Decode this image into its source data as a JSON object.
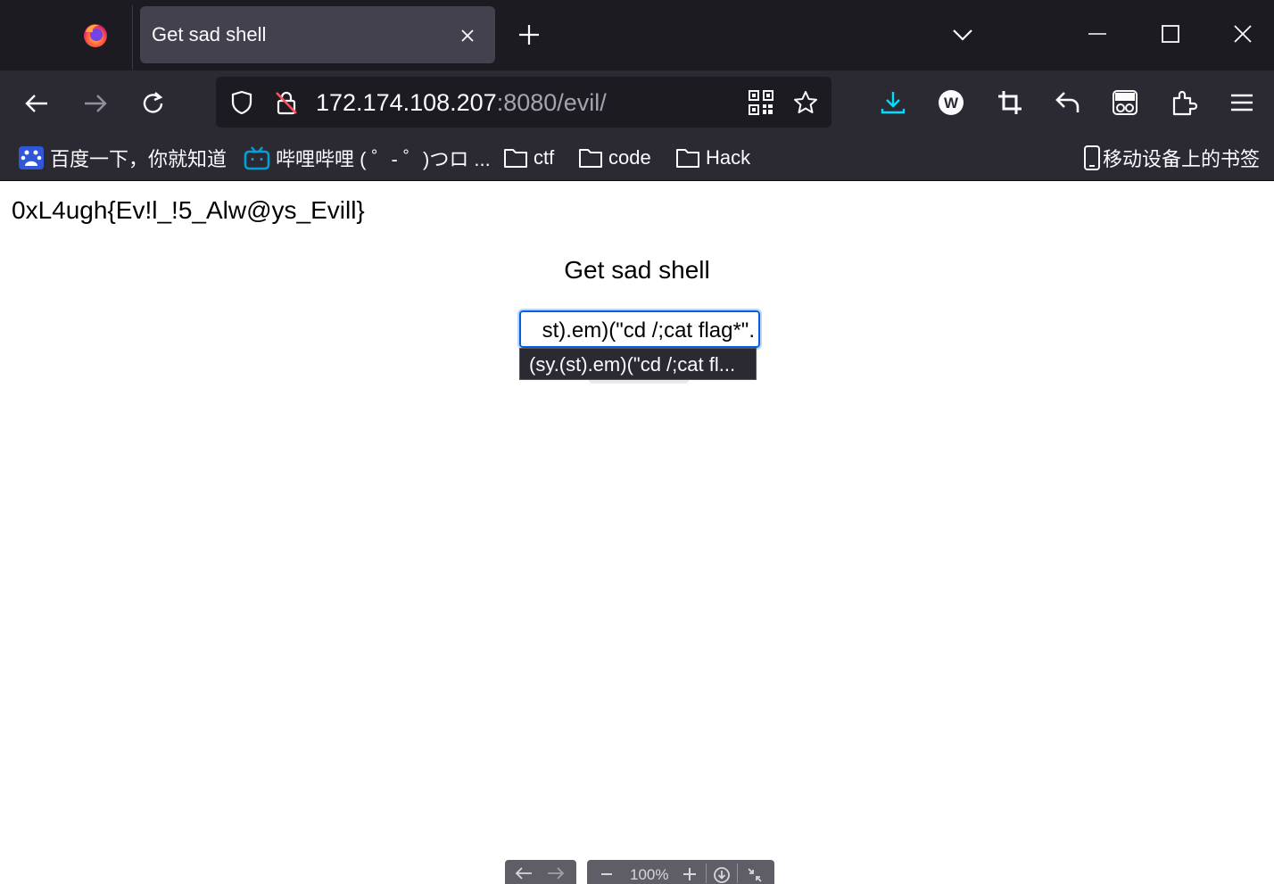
{
  "browser": {
    "tab": {
      "title": "Get sad shell"
    },
    "url": {
      "host": "172.174.108.207",
      "rest": ":8080/evil/"
    },
    "bookmarks": [
      {
        "label": "百度一下，你就知道",
        "icon": "baidu-icon"
      },
      {
        "label": "哔哩哔哩 ( ゜- ゜)つロ ...",
        "icon": "bilibili-icon"
      },
      {
        "label": "ctf",
        "icon": "folder-icon"
      },
      {
        "label": "code",
        "icon": "folder-icon"
      },
      {
        "label": "Hack",
        "icon": "folder-icon"
      }
    ],
    "mobile_bookmarks": "移动设备上的书签"
  },
  "page": {
    "flag": "0xL4ugh{Ev!l_!5_Alw@ys_Evill}",
    "title": "Get sad shell",
    "input_value": "st).em)(\"cd /;cat flag*\".",
    "autocomplete": "(sy.(st).em)(\"cd /;cat fl..."
  },
  "bottom_toolbar": {
    "zoom": "100%"
  },
  "colors": {
    "accent": "#0060df",
    "chrome_dark": "#1c1b22",
    "toolbar": "#2b2a33",
    "download": "#00ddff"
  }
}
